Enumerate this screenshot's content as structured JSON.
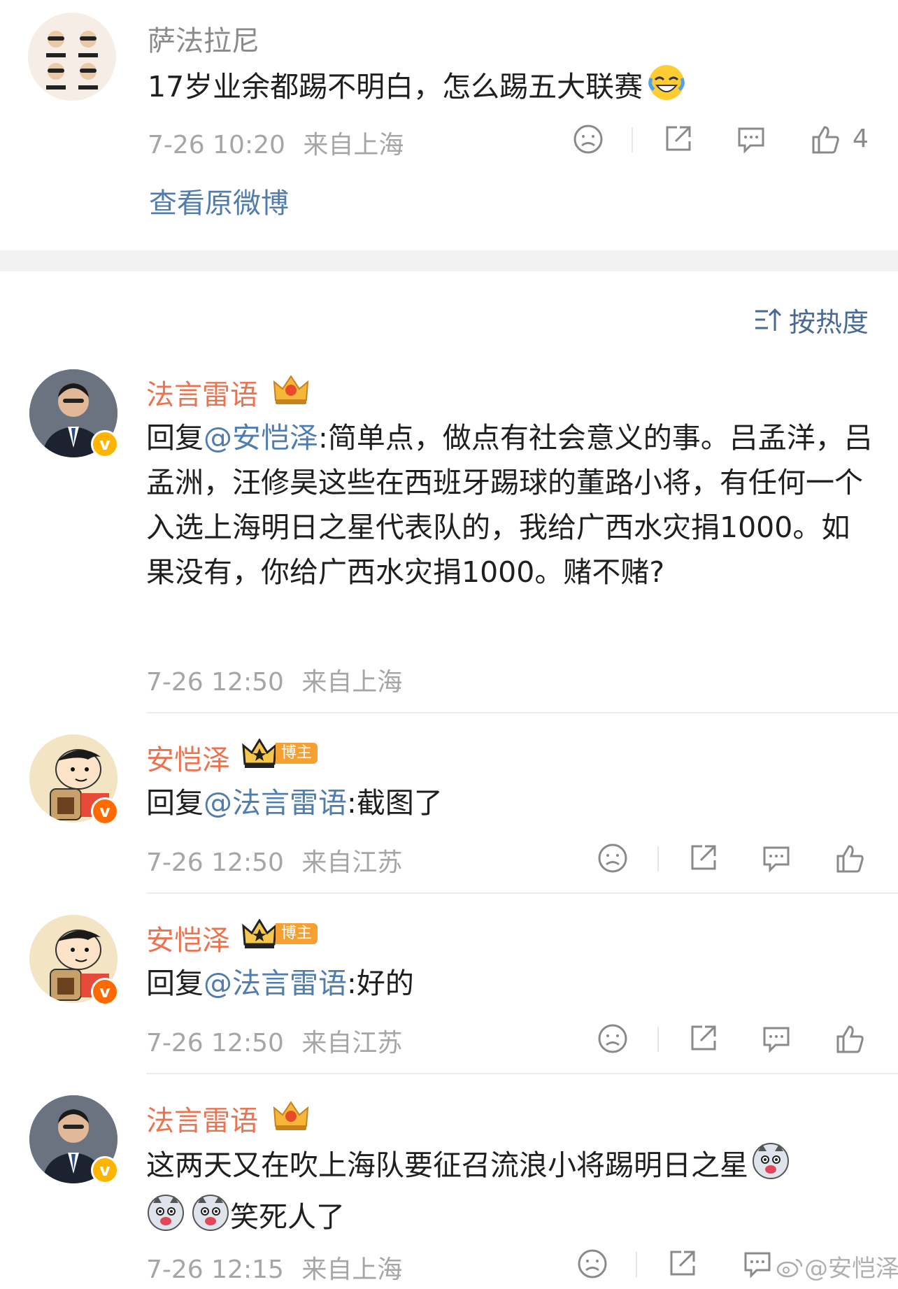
{
  "top_comment": {
    "username": "萨法拉尼",
    "text": "17岁业余都踢不明白，怎么踢五大联赛",
    "time": "7-26 10:20",
    "location": "来自上海",
    "like_count": "4",
    "view_original": "查看原微博",
    "emoji_icon": "laugh-cry-emoji"
  },
  "sort": {
    "label": "按热度",
    "icon": "sort-icon"
  },
  "replies": [
    {
      "username": "法言雷语",
      "reply_prefix": "回复",
      "mention": "@安恺泽",
      "text": ":简单点，做点有社会意义的事。吕孟洋，吕孟洲，汪修昊这些在西班牙踢球的董路小将，有任何一个入选上海明日之星代表队的，我给广西水灾捐1000。如果没有，你给广西水灾捐1000。赌不赌?",
      "time": "7-26 12:50",
      "location": "来自上海"
    },
    {
      "username": "安恺泽",
      "badge": "博主",
      "reply_prefix": "回复",
      "mention": "@法言雷语",
      "text": ":截图了",
      "time": "7-26 12:50",
      "location": "来自江苏"
    },
    {
      "username": "安恺泽",
      "badge": "博主",
      "reply_prefix": "回复",
      "mention": "@法言雷语",
      "text": ":好的",
      "time": "7-26 12:50",
      "location": "来自江苏"
    },
    {
      "username": "法言雷语",
      "text_line1": "这两天又在吹上海队要征召流浪小将踢明日之星",
      "text_line2": "笑死人了",
      "time": "7-26 12:15",
      "location": "来自上海"
    }
  ],
  "watermark": "@安恺泽",
  "colors": {
    "username_orange": "#eb7350",
    "mention_blue": "#507daf",
    "meta_gray": "#a6a6a6",
    "vip_badge": "#ffb400"
  }
}
